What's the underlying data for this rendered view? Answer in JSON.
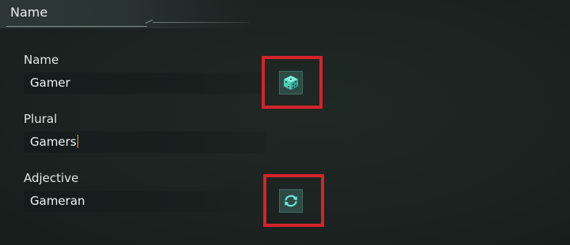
{
  "header": {
    "title": "Name"
  },
  "fields": {
    "name": {
      "label": "Name",
      "value": "Gamer"
    },
    "plural": {
      "label": "Plural",
      "value": "Gamers"
    },
    "adjective": {
      "label": "Adjective",
      "value": "Gameran"
    }
  },
  "icons": {
    "randomize": "dice-icon",
    "reset": "refresh-icon"
  },
  "colors": {
    "accent": "#5fd4c1",
    "highlight": "#d4242a",
    "caret": "#e0a642"
  }
}
